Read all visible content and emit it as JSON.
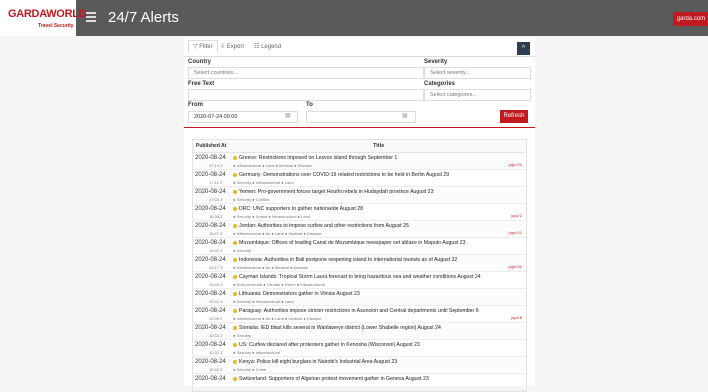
{
  "header": {
    "logo_main": "GARDAWORLD",
    "logo_sub": "Travel Security",
    "title": "24/7 Alerts",
    "garda_link": "garda.com",
    "lang": "en"
  },
  "tabs": {
    "filter": "Filter",
    "export": "Export",
    "legend": "Legend",
    "collapse": "^"
  },
  "filters": {
    "country_label": "Country",
    "country_placeholder": "Select countries...",
    "severity_label": "Severity",
    "severity_placeholder": "Select severity...",
    "freetext_label": "Free Text",
    "freetext_value": "",
    "categories_label": "Categories",
    "categories_placeholder": "Select categories...",
    "from_label": "From",
    "from_value": "2020-07-24 00:00",
    "to_label": "To",
    "to_value": "",
    "refresh_label": "Refresh"
  },
  "table": {
    "col_published": "Published At",
    "col_title": "Title",
    "rows": [
      {
        "date": "2020-08-24",
        "time": "17:13 Z",
        "color": "#e8b923",
        "title": "Greece: Restrictions imposed on Lesvos island through September 1",
        "cats": "● Infrastructural  ● Land  ● Medical  ● Disease",
        "update": "(upd 21"
      },
      {
        "date": "2020-08-24",
        "time": "17:11 Z",
        "color": "#e8b923",
        "title": "Germany: Demonstrations over COVID-19 related restrictions to be held in Berlin August 29",
        "cats": "● Security  ● Infrastructural  ● Land",
        "update": ""
      },
      {
        "date": "2020-08-24",
        "time": "17:03 Z",
        "color": "#e8b923",
        "title": "Yemen: Pro-government forces target Houthi rebels in Hudaydah province August 23",
        "cats": "● Security  ● Conflict",
        "update": ""
      },
      {
        "date": "2020-08-24",
        "time": "16:38 Z",
        "color": "#e8b923",
        "title": "DRC: UNC supporters to gather nationwide August 28",
        "cats": "● Security  ● Unrest  ● Infrastructural  ● Land",
        "update": "(upd 2"
      },
      {
        "date": "2020-08-24",
        "time": "15:47 Z",
        "color": "#e8b923",
        "title": "Jordan: Authorities to impose curfew and other restrictions from August 25",
        "cats": "● Infrastructural  ● Air  ● Land  ● Medical  ● Disease",
        "update": "(upd 21"
      },
      {
        "date": "2020-08-24",
        "time": "15:02 Z",
        "color": "#e8b923",
        "title": "Mozambique: Offices of leading Canal de Mozambique newspaper set ablaze in Maputo August 23",
        "cats": "● Security",
        "update": ""
      },
      {
        "date": "2020-08-24",
        "time": "14:17 Z",
        "color": "#e8b923",
        "title": "Indonesia: Authorities in Bali postpone reopening island to international tourists as of August 22",
        "cats": "● Infrastructural  ● Air  ● Medical  ● Disease",
        "update": "(upd 32"
      },
      {
        "date": "2020-08-24",
        "time": "13:49 Z",
        "color": "#e8b923",
        "title": "Cayman Islands: Tropical Storm Laura forecast to bring hazardous sea and weather conditions August 24",
        "cats": "● Environmental  ● Climate  ● Storm  ● Infrastructural",
        "update": ""
      },
      {
        "date": "2020-08-24",
        "time": "12:41 Z",
        "color": "#e8b923",
        "title": "Lithuania: Demonstrators gather in Vilnius August 23",
        "cats": "● Security  ● Infrastructural  ● Land",
        "update": ""
      },
      {
        "date": "2020-08-24",
        "time": "12:09 Z",
        "color": "#e8b923",
        "title": "Paraguay: Authorities impose stricter restrictions in Asuncion and Central departments until September 6",
        "cats": "● Infrastructural  ● Air  ● Land  ● Medical  ● Disease",
        "update": "(upd 8"
      },
      {
        "date": "2020-08-24",
        "time": "10:53 Z",
        "color": "#e8b923",
        "title": "Somalia: IED blast kills several in Wanlaweyn district (Lower Shabelle region) August 24",
        "cats": "● Security",
        "update": ""
      },
      {
        "date": "2020-08-24",
        "time": "10:32 Z",
        "color": "#e8b923",
        "title": "US: Curfew declared after protesters gather in Kenosha (Wisconsin) August 23",
        "cats": "● Security  ● Infrastructural",
        "update": ""
      },
      {
        "date": "2020-08-24",
        "time": "10:02 Z",
        "color": "#e8b923",
        "title": "Kenya: Police kill eight burglars in Nairobi's Industrial Area August 23",
        "cats": "● Security  ● Crime",
        "update": ""
      },
      {
        "date": "2020-08-24",
        "time": "",
        "color": "#e8b923",
        "title": "Switzerland: Supporters of Algerian protest movement gather in Geneva August 23",
        "cats": "",
        "update": ""
      }
    ]
  }
}
